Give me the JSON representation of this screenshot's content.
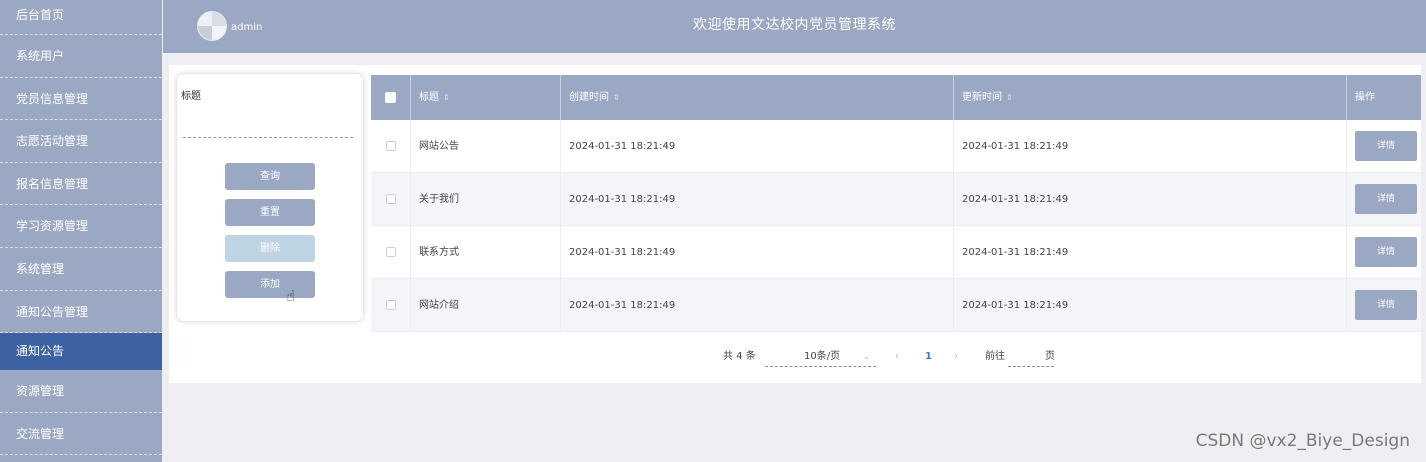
{
  "sidebar": {
    "items": [
      {
        "label": "后台首页"
      },
      {
        "label": "系统用户"
      },
      {
        "label": "党员信息管理"
      },
      {
        "label": "志愿活动管理"
      },
      {
        "label": "报名信息管理"
      },
      {
        "label": "学习资源管理"
      },
      {
        "label": "系统管理"
      },
      {
        "label": "通知公告管理"
      },
      {
        "label": "通知公告"
      },
      {
        "label": "资源管理"
      },
      {
        "label": "交流管理"
      }
    ],
    "active_index": 8
  },
  "header": {
    "username": "admin",
    "title": "欢迎使用文达校内党员管理系统"
  },
  "search": {
    "title_label": "标题",
    "title_value": "",
    "query_label": "查询",
    "reset_label": "重置",
    "delete_label": "删除",
    "add_label": "添加"
  },
  "table": {
    "columns": [
      "标题",
      "创建时间",
      "更新时间",
      "操作"
    ],
    "rows": [
      {
        "title": "网站公告",
        "created": "2024-01-31 18:21:49",
        "updated": "2024-01-31 18:21:49",
        "action": "详情"
      },
      {
        "title": "关于我们",
        "created": "2024-01-31 18:21:49",
        "updated": "2024-01-31 18:21:49",
        "action": "详情"
      },
      {
        "title": "联系方式",
        "created": "2024-01-31 18:21:49",
        "updated": "2024-01-31 18:21:49",
        "action": "详情"
      },
      {
        "title": "网站介绍",
        "created": "2024-01-31 18:21:49",
        "updated": "2024-01-31 18:21:49",
        "action": "详情"
      }
    ]
  },
  "pagination": {
    "total_text": "共 4 条",
    "page_size": "10条/页",
    "current_page": "1",
    "goto_label": "前往",
    "page_unit": "页"
  },
  "watermark": "CSDN @vx2_Biye_Design",
  "colors": {
    "primary": "#9ba8c3",
    "active_menu": "#3c62a3",
    "delete_button": "#bed4e3",
    "page_active": "#3f7ac6"
  }
}
